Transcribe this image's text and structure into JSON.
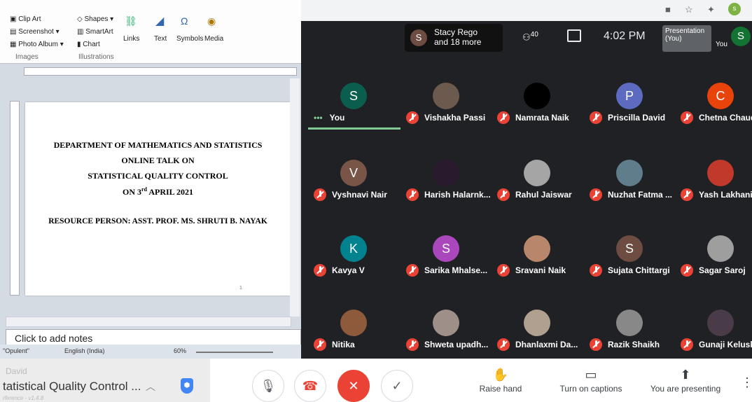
{
  "ppt": {
    "ribbon": {
      "clip_art": "Clip Art",
      "screenshot": "Screenshot",
      "photo_album": "Photo Album",
      "group_images": "Images",
      "shapes": "Shapes",
      "smartart": "SmartArt",
      "chart": "Chart",
      "group_illustrations": "Illustrations",
      "links": "Links",
      "text": "Text",
      "symbols": "Symbols",
      "media": "Media"
    },
    "slide": {
      "line1": "DEPARTMENT OF  MATHEMATICS AND STATISTICS",
      "line2": "ONLINE TALK ON",
      "line3": "STATISTICAL  QUALITY CONTROL",
      "line4_prefix": "ON 3",
      "line4_sup": "rd",
      "line4_suffix": " APRIL 2021",
      "line5": "RESOURCE  PERSON: ASST.  PROF.  MS. SHRUTI B. NAYAK",
      "page_number": "1"
    },
    "notes_placeholder": "Click to add notes",
    "status": {
      "theme": "\"Opulent\"",
      "language": "English (India)",
      "zoom": "60%"
    }
  },
  "taskbar": {
    "ghost_name": "David",
    "title": "tatistical Quality Control ...",
    "ghost_version": "rference - v1.4.8"
  },
  "meet": {
    "presenter_initial": "S",
    "presenter_line1": "Stacy Rego",
    "presenter_line2": "and 18 more",
    "participant_count": "40",
    "time": "4:02 PM",
    "presentation_label_1": "Presentation",
    "presentation_label_2": "(You)",
    "you_label": "You",
    "you_initial": "S",
    "tiles": [
      {
        "name": "You",
        "initial": "S",
        "color": "#0b5e4d",
        "muted": false,
        "you": true
      },
      {
        "name": "Vishakha Passi",
        "initial": "",
        "color": "#6d5a4e",
        "muted": true
      },
      {
        "name": "Namrata Naik",
        "initial": "",
        "color": "#000000",
        "muted": true
      },
      {
        "name": "Priscilla David",
        "initial": "P",
        "color": "#5c6bc0",
        "muted": true
      },
      {
        "name": "Chetna Chaud...",
        "initial": "C",
        "color": "#e8430a",
        "muted": true
      },
      {
        "name": "Vyshnavi Nair",
        "initial": "V",
        "color": "#795548",
        "muted": true
      },
      {
        "name": "Harish Halarnk...",
        "initial": "",
        "color": "#2a1a2e",
        "muted": true
      },
      {
        "name": "Rahul Jaiswar",
        "initial": "",
        "color": "#a5a5a5",
        "muted": true
      },
      {
        "name": "Nuzhat Fatma ...",
        "initial": "",
        "color": "#607d8b",
        "muted": true
      },
      {
        "name": "Yash Lakhani",
        "initial": "",
        "color": "#c0392b",
        "muted": true
      },
      {
        "name": "Kavya V",
        "initial": "K",
        "color": "#00838f",
        "muted": true
      },
      {
        "name": "Sarika Mhalse...",
        "initial": "S",
        "color": "#ab47bc",
        "muted": true
      },
      {
        "name": "Sravani Naik",
        "initial": "",
        "color": "#b8866b",
        "muted": true
      },
      {
        "name": "Sujata Chittargi",
        "initial": "S",
        "color": "#6d4c41",
        "muted": true
      },
      {
        "name": "Sagar Saroj",
        "initial": "",
        "color": "#9e9e9e",
        "muted": true
      },
      {
        "name": "Nitika",
        "initial": "",
        "color": "#8d5a3b",
        "muted": true
      },
      {
        "name": "Shweta upadh...",
        "initial": "",
        "color": "#9e8f88",
        "muted": true
      },
      {
        "name": "Dhanlaxmi Da...",
        "initial": "",
        "color": "#b0a090",
        "muted": true
      },
      {
        "name": "Razik Shaikh",
        "initial": "",
        "color": "#888888",
        "muted": true
      },
      {
        "name": "Gunaji Keluska...",
        "initial": "",
        "color": "#4a3b48",
        "muted": true
      }
    ],
    "actions": {
      "raise_hand": "Raise hand",
      "captions": "Turn on captions",
      "presenting": "You are presenting"
    }
  }
}
